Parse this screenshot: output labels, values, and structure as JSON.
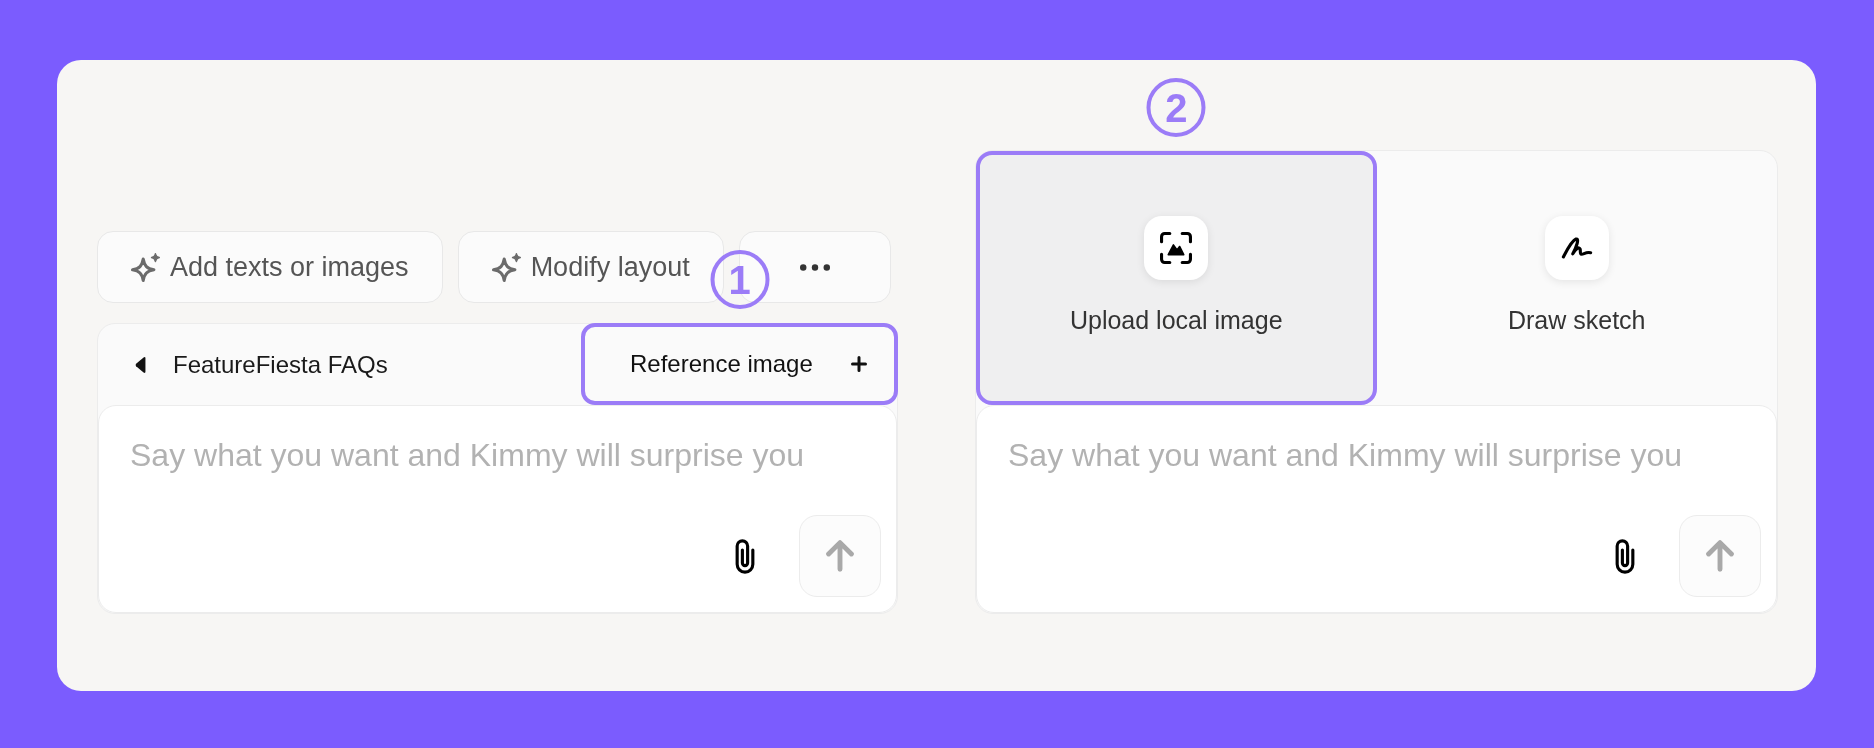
{
  "toolbar": [
    {
      "kind": "action",
      "label": "Add texts or images"
    },
    {
      "kind": "action",
      "label": "Modify layout"
    },
    {
      "kind": "more"
    }
  ],
  "left_panel": {
    "tab": {
      "label": "FeatureFiesta FAQs"
    },
    "reference_button": {
      "label": "Reference image",
      "highlighted": true,
      "annotation": "1"
    },
    "input": {
      "placeholder": "Say what you want and Kimmy will surprise you"
    }
  },
  "right_panel": {
    "options": [
      {
        "kind": "upload",
        "label": "Upload local image",
        "selected": true,
        "annotation": "2"
      },
      {
        "kind": "sketch",
        "label": "Draw sketch",
        "selected": false
      }
    ],
    "input": {
      "placeholder": "Say what you want and Kimmy will surprise you"
    }
  }
}
